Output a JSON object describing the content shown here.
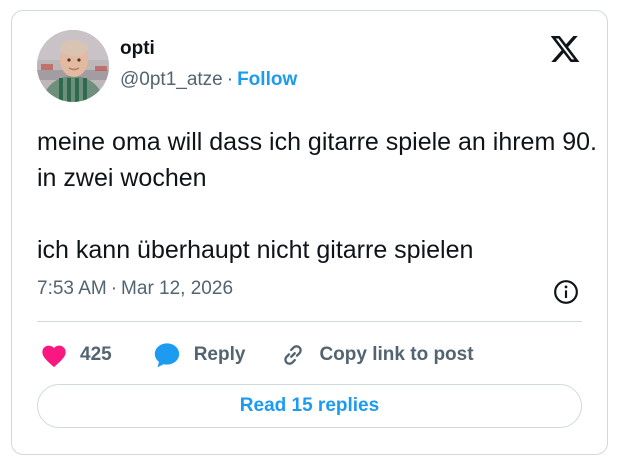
{
  "author": {
    "name": "opti",
    "handle": "@0pt1_atze",
    "separator": "·",
    "follow_label": "Follow",
    "avatar_icon": "avatar-photo"
  },
  "brand": {
    "logo_icon": "x-logo-icon"
  },
  "tweet": {
    "text": "meine oma will dass ich gitarre spiele an ihrem 90. in zwei wochen\n\nich kann überhaupt nicht gitarre spielen"
  },
  "meta": {
    "time": "7:53 AM",
    "separator": "·",
    "date": "Mar 12, 2026",
    "info_icon": "info-icon"
  },
  "actions": {
    "likes_count": "425",
    "reply_label": "Reply",
    "copy_link_label": "Copy link to post"
  },
  "replies_button": {
    "label": "Read 15 replies"
  },
  "colors": {
    "accent": "#1d9bf0",
    "heart": "#f91880",
    "text": "#0f1419",
    "secondary": "#536471",
    "border": "#cfd9de"
  }
}
